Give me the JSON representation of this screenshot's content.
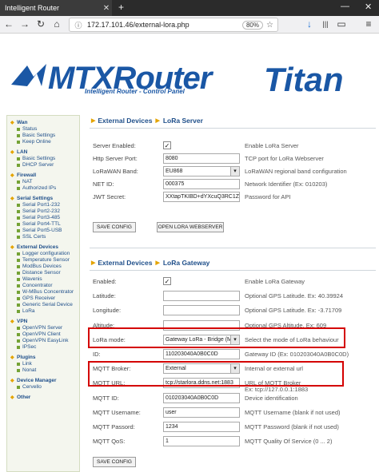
{
  "browser": {
    "tab_title": "Intelligent Router",
    "tab_close": "✕",
    "new_tab": "+",
    "min": "—",
    "close": "✕",
    "back": "←",
    "forward": "→",
    "reload": "↻",
    "home": "⌂",
    "url": "172.17.101.46/external-lora.php",
    "zoom": "80%",
    "star": "☆",
    "download": "↓",
    "library": "|||",
    "reader": "▭",
    "menu": "≡"
  },
  "header": {
    "logo_main": "MTXRouter",
    "logo_sub": "Intelligent Router - Control Panel",
    "logo_titan": "Titan"
  },
  "sidebar": [
    {
      "title": "Wan",
      "items": [
        "Status",
        "Basic Settings",
        "Keep Online"
      ]
    },
    {
      "title": "LAN",
      "items": [
        "Basic Settings",
        "DHCP Server"
      ]
    },
    {
      "title": "Firewall",
      "items": [
        "NAT",
        "Authorized IPs"
      ]
    },
    {
      "title": "Serial Settings",
      "items": [
        "Serial Port1-232",
        "Serial Port2-232",
        "Serial Port3-485",
        "Serial Port4-TTL",
        "Serial Port5-USB",
        "SSL Certs"
      ]
    },
    {
      "title": "External Devices",
      "items": [
        "Logger configuration",
        "Temperature Sensor",
        "ModBus Devices",
        "Distance Sensor",
        "Wavenis",
        "Concentrator",
        "W-MBus Concentrator",
        "GPS Receiver",
        "Generic Serial Device",
        "LoRa"
      ]
    },
    {
      "title": "VPN",
      "items": [
        "OpenVPN Server",
        "OpenVPN Client",
        "OpenVPN EasyLink",
        "IPSec"
      ]
    },
    {
      "title": "Plugins",
      "items": [
        "Link",
        "Nonat"
      ]
    },
    {
      "title": "Device Manager",
      "items": [
        "Cervello"
      ]
    },
    {
      "title": "Other",
      "items": []
    }
  ],
  "lora_server": {
    "crumb_a": "External Devices",
    "crumb_b": "LoRa Server",
    "fields": [
      {
        "label": "Server Enabled:",
        "type": "checkbox",
        "value": "✓",
        "desc": "Enable LoRa Server"
      },
      {
        "label": "Http Server Port:",
        "type": "text",
        "value": "8080",
        "desc": "TCP port for LoRa Webserver"
      },
      {
        "label": "LoRaWAN Band:",
        "type": "select",
        "value": "EU868",
        "desc": "LoRaWAN regional band configuration"
      },
      {
        "label": "NET ID:",
        "type": "text",
        "value": "000375",
        "desc": "Network Identifier (Ex: 010203)"
      },
      {
        "label": "JWT Secret:",
        "type": "text",
        "value": "XXtapTKIBD+dYXcuQ3RC1Zt",
        "desc": "Password for API"
      }
    ],
    "btn_save": "SAVE CONFIG",
    "btn_open": "OPEN LORA WEBSERVER"
  },
  "lora_gateway": {
    "crumb_a": "External Devices",
    "crumb_b": "LoRa Gateway",
    "fields": [
      {
        "label": "Enabled:",
        "type": "checkbox",
        "value": "✓",
        "desc": "Enable LoRa Gateway",
        "desc2": ""
      },
      {
        "label": "Latitude:",
        "type": "text",
        "value": "",
        "desc": "Optional GPS Latitude. Ex: 40.39924",
        "desc2": ""
      },
      {
        "label": "Longitude:",
        "type": "text",
        "value": "",
        "desc": "Optional GPS Latitude. Ex: -3.71709",
        "desc2": ""
      },
      {
        "label": "Altitude:",
        "type": "text",
        "value": "",
        "desc": "Optional GPS Altitude. Ex: 609",
        "desc2": ""
      },
      {
        "label": "LoRa mode:",
        "type": "select",
        "value": "Gateway LoRa - Bridge (MQTT)",
        "desc": "Select the mode of LoRa behaviour",
        "desc2": ""
      },
      {
        "label": "ID:",
        "type": "text",
        "value": "110203040A0B0C0D",
        "desc": "Gateway ID (Ex: 010203040A0B0C0D)",
        "desc2": ""
      },
      {
        "label": "MQTT Broker:",
        "type": "select",
        "value": "External",
        "desc": "Internal or external url",
        "desc2": ""
      },
      {
        "label": "MQTT URL:",
        "type": "text",
        "value": "tcp://starlora.ddns.net:1883",
        "desc": "URL of MQTT Broker",
        "desc2": "Ex: tcp://127.0.0.1:1883"
      },
      {
        "label": "MQTT ID:",
        "type": "text",
        "value": "010203040A0B0C0D",
        "desc": "Device identification",
        "desc2": ""
      },
      {
        "label": "MQTT Username:",
        "type": "text",
        "value": "user",
        "desc": "MQTT Username (blank if not used)",
        "desc2": ""
      },
      {
        "label": "MQTT Passord:",
        "type": "text",
        "value": "1234",
        "desc": "MQTT Password (blank if not used)",
        "desc2": ""
      },
      {
        "label": "MQTT QoS:",
        "type": "text",
        "value": "1",
        "desc": "MQTT Quality Of Service (0 ... 2)",
        "desc2": ""
      }
    ],
    "btn_save": "SAVE CONFIG"
  }
}
